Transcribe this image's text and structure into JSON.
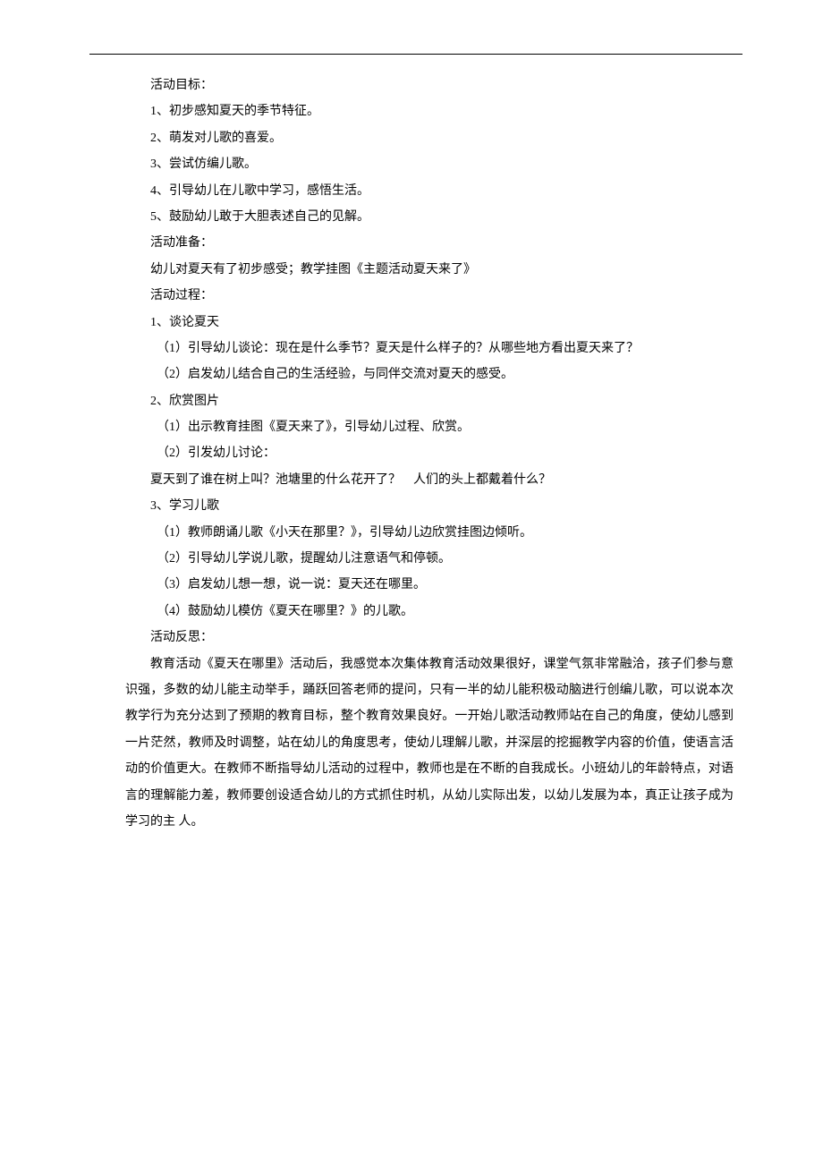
{
  "section_goals_title": "活动目标：",
  "goals": [
    "1、初步感知夏天的季节特征。",
    "2、萌发对儿歌的喜爱。",
    "3、尝试仿编儿歌。",
    "4、引导幼儿在儿歌中学习，感悟生活。",
    "5、鼓励幼儿敢于大胆表述自己的见解。"
  ],
  "section_prep_title": "活动准备：",
  "prep_text": "幼儿对夏天有了初步感受；教学挂图《主题活动夏天来了》",
  "section_process_title": "活动过程：",
  "process_1_title": "1、谈论夏天",
  "process_1_items": [
    "（1）引导幼儿谈论：现在是什么季节？夏天是什么样子的？从哪些地方看出夏天来了？",
    "（2）启发幼儿结合自己的生活经验，与同伴交流对夏天的感受。"
  ],
  "process_2_title": "2、欣赏图片",
  "process_2_items": [
    "（1）出示教育挂图《夏天来了》，引导幼儿过程、欣赏。",
    "（2）引发幼儿讨论："
  ],
  "process_2_question": "夏天到了谁在树上叫？池塘里的什么花开了？　人们的头上都戴着什么？",
  "process_3_title": "3、学习儿歌",
  "process_3_items": [
    "（1）教师朗诵儿歌《小天在那里？》，引导幼儿边欣赏挂图边倾听。",
    "（2）引导幼儿学说儿歌，提醒幼儿注意语气和停顿。",
    "（3）启发幼儿想一想，说一说：夏天还在哪里。",
    "（4）鼓励幼儿模仿《夏天在哪里？》的儿歌。"
  ],
  "section_reflect_title": "活动反思：",
  "reflect_text": "教育活动《夏天在哪里》活动后，我感觉本次集体教育活动效果很好，课堂气氛非常融洽，孩子们参与意识强，多数的幼儿能主动举手，踊跃回答老师的提问，只有一半的幼儿能积极动脑进行创编儿歌，可以说本次教学行为充分达到了预期的教育目标，整个教育效果良好。一开始儿歌活动教师站在自己的角度，使幼儿感到一片茫然，教师及时调整，站在幼儿的角度思考，使幼儿理解儿歌，并深层的挖掘教学内容的价值，使语言活动的价值更大。在教师不断指导幼儿活动的过程中，教师也是在不断的自我成长。小班幼儿的年龄特点，对语言的理解能力差，教师要创设适合幼儿的方式抓住时机，从幼儿实际出发，以幼儿发展为本，真正让孩子成为学习的主 人。"
}
